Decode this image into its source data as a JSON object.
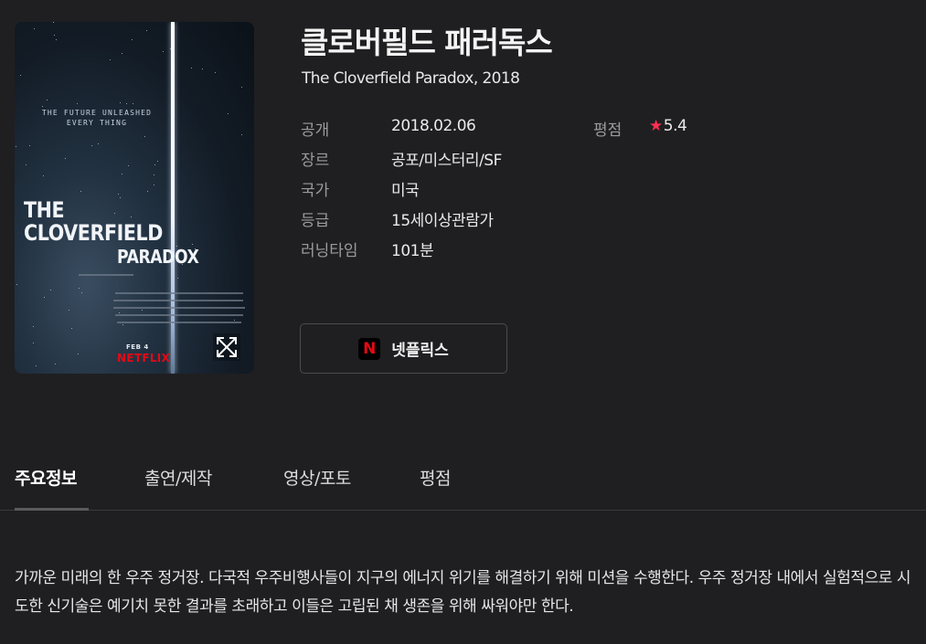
{
  "movie": {
    "title_ko": "클로버필드 패러독스",
    "subtitle": "The Cloverfield Paradox, 2018"
  },
  "poster": {
    "tagline": "THE FUTURE UNLEASHED\nEVERY THING",
    "title_line": "THE\nCLOVERFIELD",
    "title_sub": "PARADOX",
    "date_text": "FEB 4",
    "brand_text": "NETFLIX",
    "expand_icon": "expand-arrows-icon"
  },
  "info": {
    "release": {
      "label": "공개",
      "value": "2018.02.06"
    },
    "genre": {
      "label": "장르",
      "value": "공포/미스터리/SF"
    },
    "country": {
      "label": "국가",
      "value": "미국"
    },
    "rating_grade": {
      "label": "등급",
      "value": "15세이상관람가"
    },
    "runtime": {
      "label": "러닝타임",
      "value": "101분"
    },
    "score": {
      "label": "평점",
      "value": "5.4",
      "star_color": "#ff2f51"
    }
  },
  "watch_button": {
    "icon_letter": "N",
    "label": "넷플릭스",
    "icon_color": "#e50914"
  },
  "tabs": [
    {
      "label": "주요정보",
      "active": true
    },
    {
      "label": "출연/제작",
      "active": false
    },
    {
      "label": "영상/포토",
      "active": false
    },
    {
      "label": "평점",
      "active": false
    }
  ],
  "synopsis": "가까운 미래의 한 우주 정거장. 다국적 우주비행사들이 지구의 에너지 위기를 해결하기 위해 미션을 수행한다. 우주 정거장 내에서 실험적으로 시도한 신기술은 예기치 못한 결과를 초래하고 이들은 고립된 채 생존을 위해 싸워야만 한다."
}
